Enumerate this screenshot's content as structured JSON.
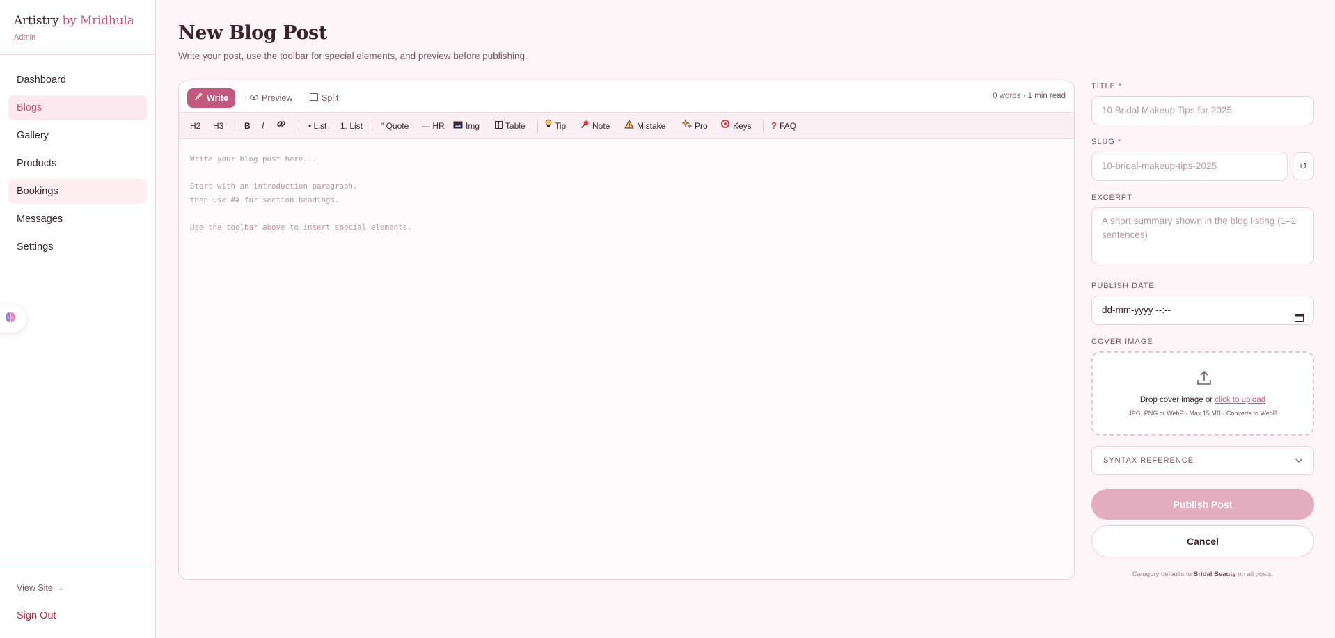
{
  "brand": {
    "name": "Artistry",
    "by": "by Mridhula",
    "role": "Admin"
  },
  "sidebar": {
    "items": [
      {
        "label": "Dashboard"
      },
      {
        "label": "Blogs"
      },
      {
        "label": "Gallery"
      },
      {
        "label": "Products"
      },
      {
        "label": "Bookings"
      },
      {
        "label": "Messages"
      },
      {
        "label": "Settings"
      }
    ],
    "active": "Blogs",
    "view_site": "View Site →",
    "sign_out": "Sign Out"
  },
  "page": {
    "title": "New Blog Post",
    "subtitle": "Write your post, use the toolbar for special elements, and preview before publishing."
  },
  "editor": {
    "modes": [
      {
        "label": "Write",
        "icon": "pencil-icon"
      },
      {
        "label": "Preview",
        "icon": "eye-icon"
      },
      {
        "label": "Split",
        "icon": "split-icon"
      }
    ],
    "active_mode": "Write",
    "word_count": "0 words · 1 min read",
    "toolbar": {
      "h2": "H2",
      "h3": "H3",
      "bold": "B",
      "italic": "I",
      "bullet_list": "• List",
      "numbered_list": "1. List",
      "quote": "\" Quote",
      "hr": "— HR",
      "img": "Img",
      "table": "Table",
      "tip": "Tip",
      "note": "Note",
      "mistake": "Mistake",
      "pro": "Pro",
      "keys": "Keys",
      "faq": "FAQ"
    },
    "placeholder": "Write your blog post here...\n\nStart with an introduction paragraph,\nthen use ## for section headings.\n\nUse the toolbar above to insert special elements."
  },
  "form": {
    "title_label": "TITLE",
    "title_placeholder": "10 Bridal Makeup Tips for 2025",
    "slug_label": "SLUG",
    "slug_placeholder": "10-bridal-makeup-tips-2025",
    "refresh": "↺",
    "required_mark": "*",
    "excerpt_label": "EXCERPT",
    "excerpt_placeholder": "A short summary shown in the blog listing (1–2 sentences)",
    "publish_date_label": "PUBLISH DATE",
    "publish_date_value": "dd-mm-yyyy --:--",
    "cover_label": "COVER IMAGE",
    "cover_drop": "Drop cover image or",
    "cover_link": "click to upload",
    "cover_hint": "JPG, PNG or WebP · Max 15 MB · Converts to WebP",
    "syntax_label": "SYNTAX REFERENCE",
    "publish_button": "Publish Post",
    "cancel_button": "Cancel",
    "footnote_prefix": "Category defaults to",
    "footnote_category": "Bridal Beauty",
    "footnote_suffix": "on all posts."
  },
  "colors": {
    "accent": "#c2587f",
    "publish_disabled": "#e3adc0",
    "danger": "#c0283e",
    "background": "#fdf5f7"
  }
}
